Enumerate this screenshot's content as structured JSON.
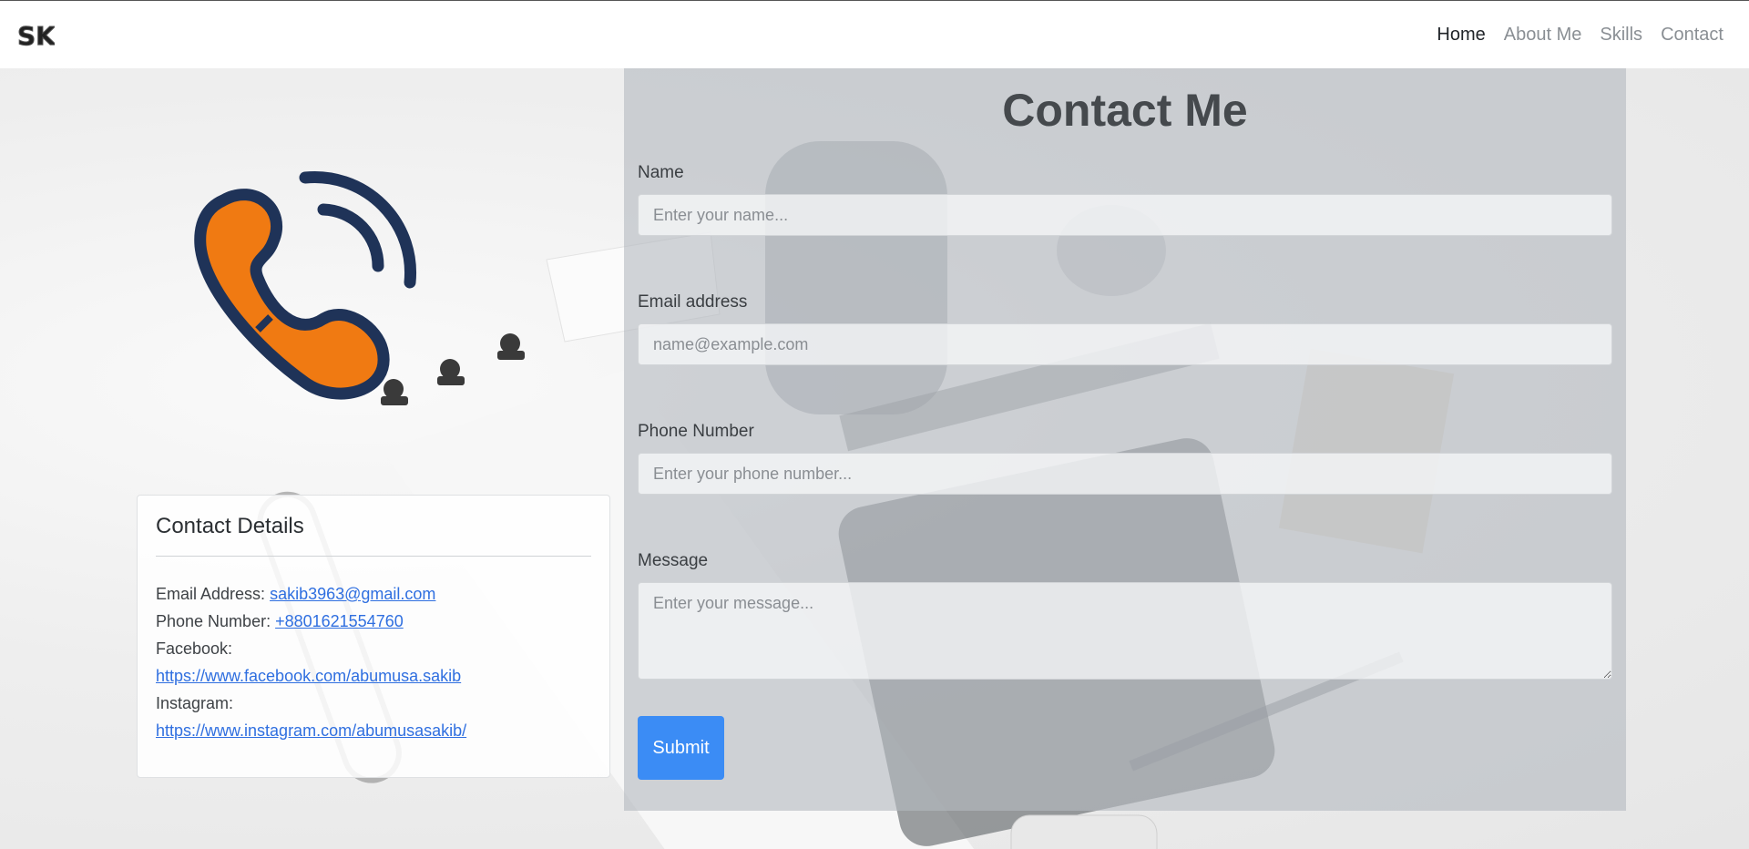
{
  "navbar": {
    "brand": "SK",
    "links": [
      {
        "label": "Home",
        "active": true
      },
      {
        "label": "About Me",
        "active": false
      },
      {
        "label": "Skills",
        "active": false
      },
      {
        "label": "Contact",
        "active": false
      }
    ]
  },
  "contact_details": {
    "title": "Contact Details",
    "email_label": "Email Address: ",
    "email": "sakib3963@gmail.com",
    "phone_label": "Phone Number: ",
    "phone": "+8801621554760",
    "facebook_label": "Facebook:",
    "facebook": "https://www.facebook.com/abumusa.sakib",
    "instagram_label": "Instagram:",
    "instagram": "https://www.instagram.com/abumusasakib/"
  },
  "form": {
    "title": "Contact Me",
    "name_label": "Name",
    "name_placeholder": "Enter your name...",
    "email_label": "Email address",
    "email_placeholder": "name@example.com",
    "phone_label": "Phone Number",
    "phone_placeholder": "Enter your phone number...",
    "message_label": "Message",
    "message_placeholder": "Enter your message...",
    "submit_label": "Submit"
  },
  "colors": {
    "accent": "#3b8cf5",
    "logo_orange": "#f07a12",
    "logo_navy": "#1f3358"
  },
  "icons": [
    "brand-logo-icon",
    "phone-call-icon"
  ]
}
